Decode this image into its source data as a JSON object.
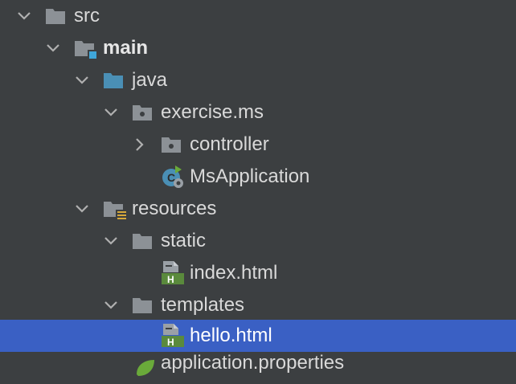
{
  "tree": {
    "src": {
      "label": "src"
    },
    "main": {
      "label": "main"
    },
    "java": {
      "label": "java"
    },
    "exercise_ms": {
      "label": "exercise.ms"
    },
    "controller": {
      "label": "controller"
    },
    "ms_application": {
      "label": "MsApplication"
    },
    "resources": {
      "label": "resources"
    },
    "static": {
      "label": "static"
    },
    "index_html": {
      "label": "index.html"
    },
    "templates": {
      "label": "templates"
    },
    "hello_html": {
      "label": "hello.html"
    },
    "application_properties": {
      "label": "application.properties"
    }
  },
  "colors": {
    "background": "#3c3f41",
    "selection": "#3a60c4",
    "folder_gray": "#8c9196",
    "folder_blue": "#4a8fb5",
    "html_green": "#5a8a3c",
    "spring_green": "#6aaa3a"
  },
  "selected": "hello.html"
}
